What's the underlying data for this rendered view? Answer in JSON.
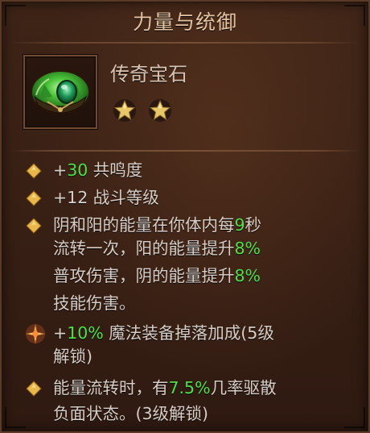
{
  "panel": {
    "title": "力量与统御"
  },
  "item": {
    "icon": "green-gem-icon",
    "name": "传奇宝石",
    "stars": 2
  },
  "stats": [
    {
      "bullet": "diamond-bullet-icon",
      "prefix": "+",
      "value": "30",
      "label": " 共鸣度"
    },
    {
      "bullet": "diamond-bullet-icon",
      "prefix": "",
      "value": "+12",
      "label": " 战斗等级"
    }
  ],
  "effect_1": {
    "bullet": "diamond-bullet-icon",
    "line1_a": "阴和阳的能量在你体内每",
    "line1_value": "9",
    "line1_b": "秒",
    "line2_a": "流转一次，阳的能量提升",
    "line2_value": "8%",
    "line3_a": "普攻伤害，阴的能量提升",
    "line3_value": "8%",
    "line4_a": "技能伤害。"
  },
  "effect_2": {
    "bullet": "sparkle-bullet-icon",
    "prefix": "+",
    "value": "10%",
    "line1_b": " 魔法装备掉落加成(5级",
    "line2": "解锁)"
  },
  "effect_3": {
    "bullet": "diamond-bullet-icon",
    "line1_a": "能量流转时，有",
    "line1_value": "7.5%",
    "line1_b": "几率驱散",
    "line2": "负面状态。(3级解锁)"
  },
  "colors": {
    "value_green": "#4fe04a",
    "text": "#d8cec6",
    "title": "#e4c3a0",
    "gem_green": "#3fae3a",
    "star_gold": "#e8c66a"
  }
}
